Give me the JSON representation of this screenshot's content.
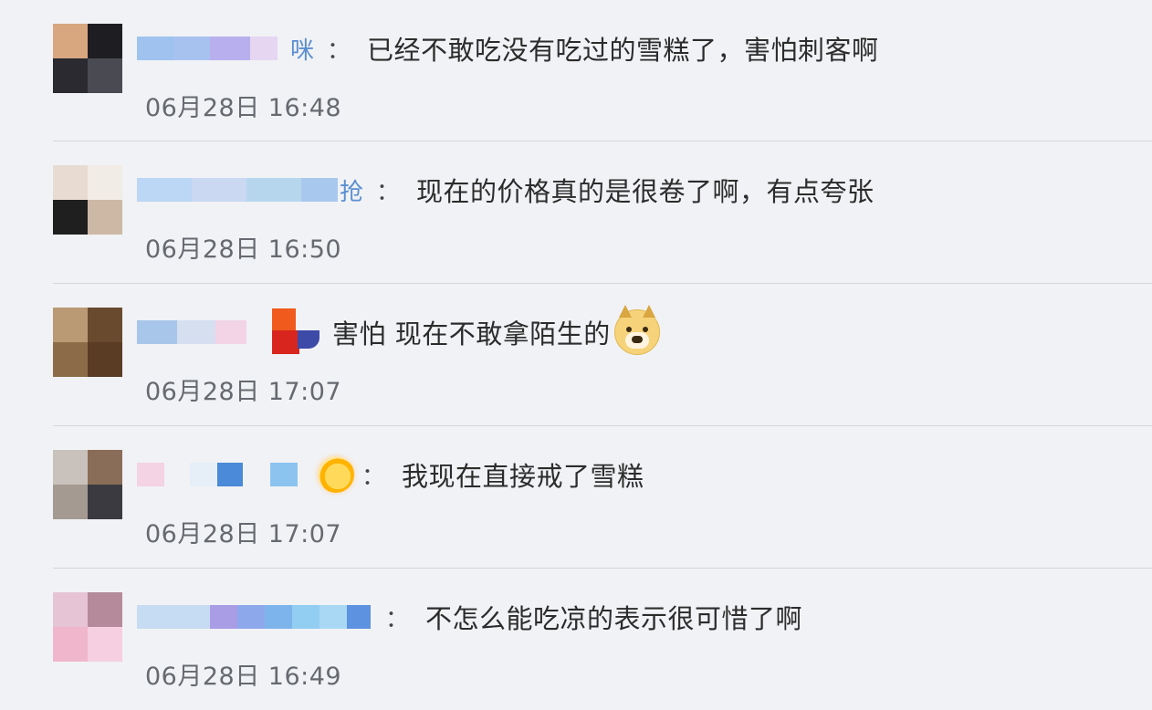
{
  "comments": [
    {
      "name_visible": "咪",
      "separator": "：",
      "text": "已经不敢吃没有吃过的雪糕了，害怕刺客啊",
      "time": "06月28日 16:48"
    },
    {
      "name_visible": "抢",
      "separator": "：",
      "text": "现在的价格真的是很卷了啊，有点夸张",
      "time": "06月28日 16:50"
    },
    {
      "name_visible": "",
      "separator": "",
      "text": "害怕 现在不敢拿陌生的",
      "emoji_icon": "doge-emoji-icon",
      "time": "06月28日 17:07"
    },
    {
      "name_visible": "",
      "separator": "：",
      "text": "我现在直接戒了雪糕",
      "time": "06月28日 17:07"
    },
    {
      "name_visible": "",
      "separator": "：",
      "text": "不怎么能吃凉的表示很可惜了啊",
      "time": "06月28日 16:49"
    }
  ],
  "colors": {
    "background": "#f1f2f5",
    "username": "#5b8fd0",
    "text": "#2c2c2c",
    "timestamp": "#666a70",
    "divider": "#d4d6db"
  }
}
